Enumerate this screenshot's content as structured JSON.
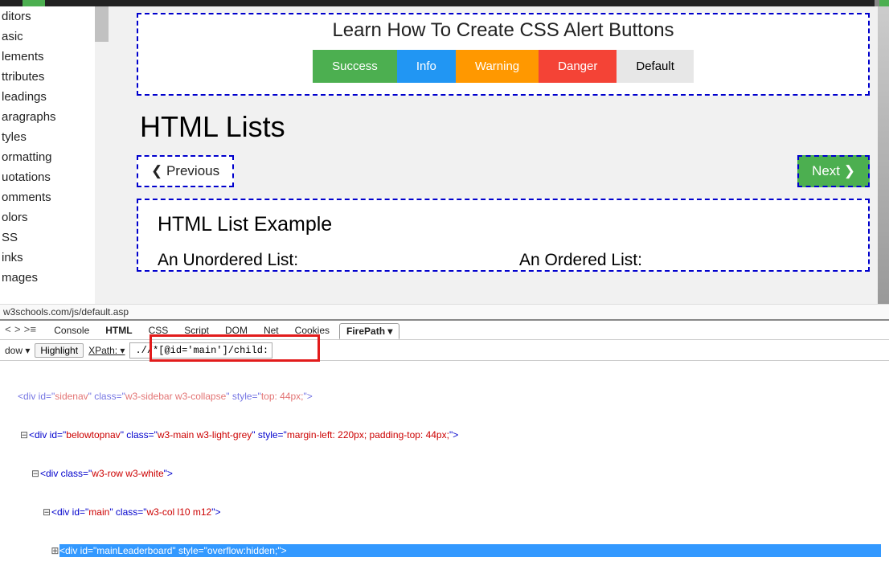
{
  "sidebar": {
    "items": [
      {
        "label": "ditors"
      },
      {
        "label": "asic"
      },
      {
        "label": "lements"
      },
      {
        "label": "ttributes"
      },
      {
        "label": "leadings"
      },
      {
        "label": "aragraphs"
      },
      {
        "label": "tyles"
      },
      {
        "label": "ormatting"
      },
      {
        "label": "uotations"
      },
      {
        "label": "omments"
      },
      {
        "label": "olors"
      },
      {
        "label": "SS"
      },
      {
        "label": "inks"
      },
      {
        "label": "mages"
      }
    ]
  },
  "ad": {
    "title": "Learn How To Create CSS Alert Buttons",
    "buttons": {
      "success": "Success",
      "info": "Info",
      "warning": "Warning",
      "danger": "Danger",
      "default": "Default"
    }
  },
  "page": {
    "heading": "HTML Lists",
    "prev": "❮ Previous",
    "next": "Next ❯"
  },
  "example": {
    "title": "HTML List Example",
    "unordered": "An Unordered List:",
    "ordered": "An Ordered List:"
  },
  "status_url": "w3schools.com/js/default.asp",
  "devtools": {
    "nav1": "<",
    "nav2": ">",
    "nav3": ">≡",
    "tabs": [
      "Console",
      "HTML",
      "CSS",
      "Script",
      "DOM",
      "Net",
      "Cookies"
    ],
    "active_tab": "FirePath ▾",
    "row2": {
      "dow": "dow ▾",
      "highlight": "Highlight",
      "xpath": "XPath: ▾"
    },
    "xpath_value": ".//*[@id='main']/child::div",
    "src": {
      "l0_pre": "<div id=\"",
      "l0_id": "sidenav",
      "l0_mid": "\" class=\"",
      "l0_cls": "w3-sidebar w3-collapse",
      "l0_post": "\" style=\"",
      "l0_sty": "top: 44px;",
      "l0_end": "\">",
      "l1_pre": "<div id=\"",
      "l1_id": "belowtopnav",
      "l1_mid": "\" class=\"",
      "l1_cls": "w3-main w3-light-grey",
      "l1_post": "\" style=\"",
      "l1_sty": "margin-left: 220px; padding-top: 44px;",
      "l1_end": "\">",
      "l2_pre": "<div class=\"",
      "l2_cls": "w3-row w3-white",
      "l2_end": "\">",
      "l3_pre": "<div id=\"",
      "l3_id": "main",
      "l3_mid": "\" class=\"",
      "l3_cls": "w3-col l10 m12",
      "l3_end": "\">",
      "l4_pre": "<div id=\"",
      "l4_id": "mainLeaderboard",
      "l4_mid": "\" style=\"",
      "l4_sty": "overflow:hidden;",
      "l4_end": "\">"
    }
  }
}
